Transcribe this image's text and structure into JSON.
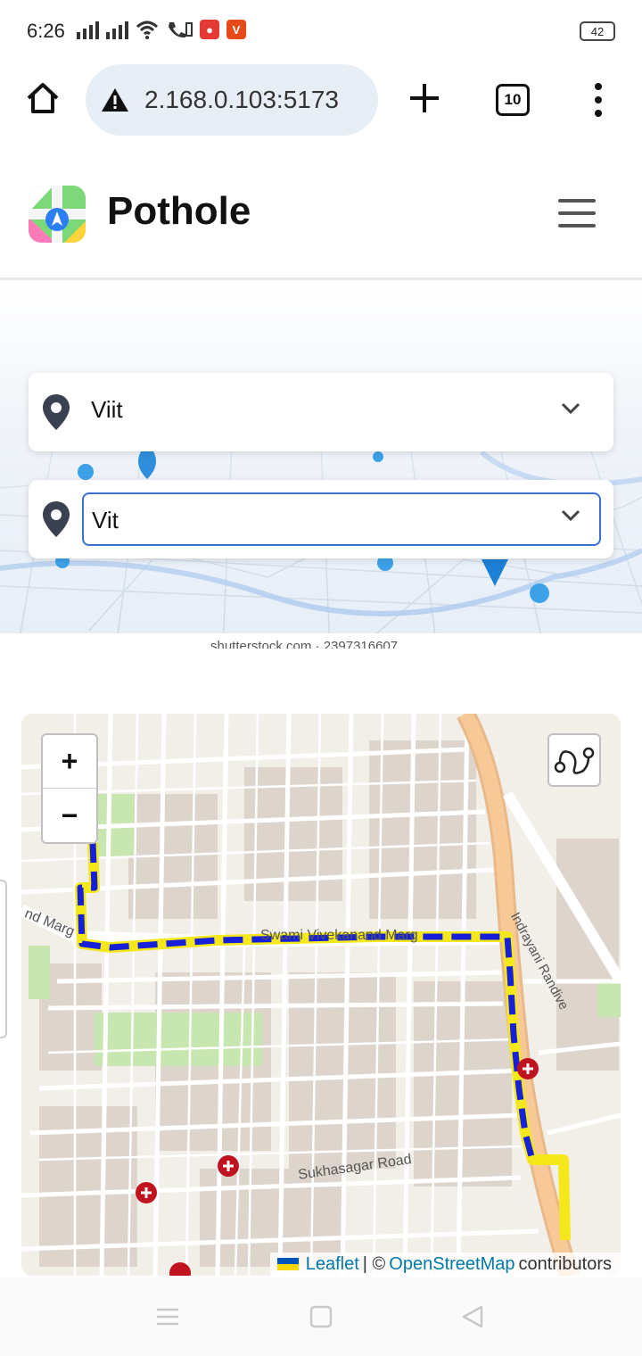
{
  "status_bar": {
    "time": "6:26",
    "battery": "42"
  },
  "browser": {
    "url": "2.168.0.103:5173",
    "tab_count": "10"
  },
  "app": {
    "title": "Pothole"
  },
  "route": {
    "from_value": "Viit",
    "to_value": "Vit"
  },
  "hero": {
    "watermark": "shutterstock.com · 2397316607"
  },
  "map": {
    "zoom_in": "+",
    "zoom_out": "−",
    "road_labels": {
      "road_left": "nd Marg",
      "road_mid": "Swami Vivekanand Marg",
      "road_right": "Indrayani Randive",
      "road_bottom": "Sukhasagar Road"
    },
    "attribution": {
      "leaflet": "Leaflet",
      "separator": "| ©",
      "osm": "OpenStreetMap",
      "suffix": "contributors"
    }
  },
  "colors": {
    "route_outer": "#f5e81a",
    "route_inner": "#1520d8",
    "accent": "#3b6fd1",
    "hospital_marker": "#c1121f"
  },
  "icons": [
    "home-icon",
    "warning-icon",
    "plus-icon",
    "tabs-icon",
    "more-icon",
    "app-logo-icon",
    "hamburger-icon",
    "location-pin-icon",
    "chevron-down-icon",
    "routing-icon",
    "hospital-marker-icon"
  ]
}
